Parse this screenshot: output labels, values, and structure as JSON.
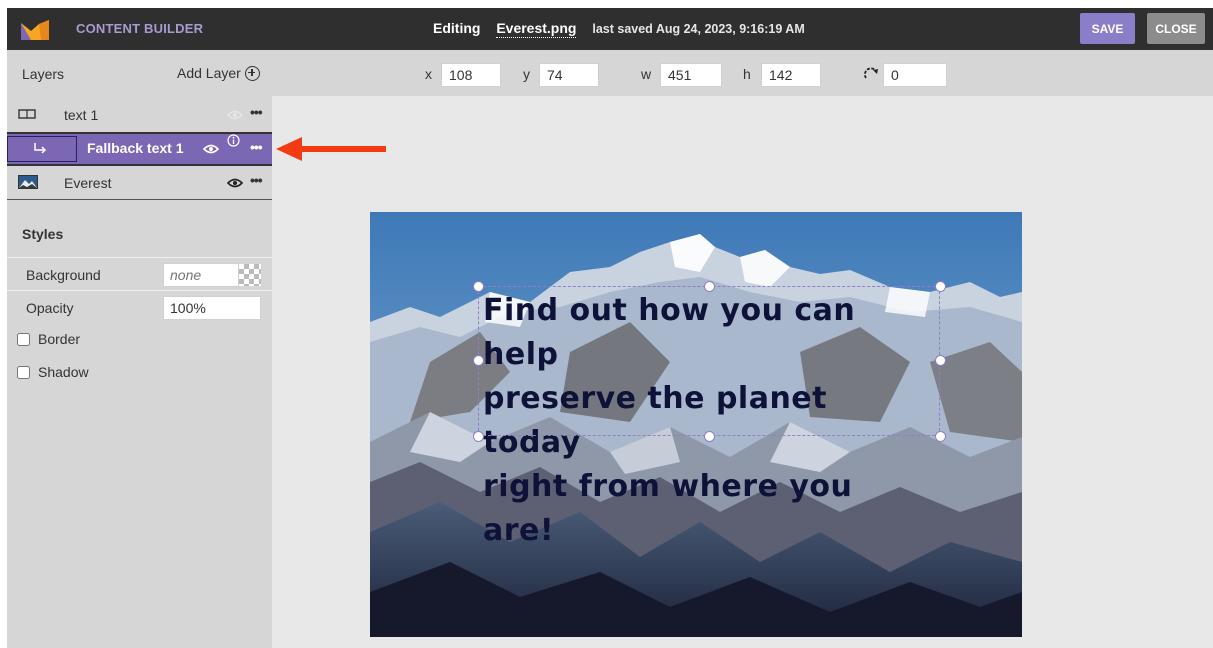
{
  "topbar": {
    "app_title": "CONTENT BUILDER",
    "editing_label": "Editing",
    "file_name": "Everest.png",
    "last_saved": "last saved Aug 24, 2023, 9:16:19 AM",
    "save_label": "SAVE",
    "close_label": "CLOSE",
    "logo_icon": "brand-logo-icon",
    "logo_colors": [
      "#f5a623",
      "#7b67b4"
    ]
  },
  "layers": {
    "title": "Layers",
    "add_label": "Add Layer",
    "items": [
      {
        "label": "text 1",
        "icon": "text-layer-icon",
        "visible": false,
        "selected": false
      },
      {
        "label": "Fallback text 1",
        "icon": "child-arrow-icon",
        "visible": true,
        "selected": true,
        "info_icon": "info-icon"
      },
      {
        "label": "Everest",
        "icon": "image-layer-icon",
        "visible": true,
        "selected": false
      }
    ]
  },
  "styles": {
    "title": "Styles",
    "background_label": "Background",
    "background_placeholder": "none",
    "opacity_label": "Opacity",
    "opacity_value": "100%",
    "border_label": "Border",
    "shadow_label": "Shadow"
  },
  "toolbar": {
    "x_label": "x",
    "x_value": "108",
    "y_label": "y",
    "y_value": "74",
    "w_label": "w",
    "w_value": "451",
    "h_label": "h",
    "h_value": "142",
    "rotation_value": "0",
    "rotation_icon": "rotate-icon"
  },
  "canvas": {
    "headline": "Find out how you can help\npreserve the planet today\nright from where you are!"
  },
  "colors": {
    "accent": "#7b67b4",
    "topbar": "#2f2f2f",
    "panel": "#d6d6d6",
    "canvas_bg": "#e8e8e8",
    "headline": "#0e1138",
    "arrow": "#f23b13"
  }
}
